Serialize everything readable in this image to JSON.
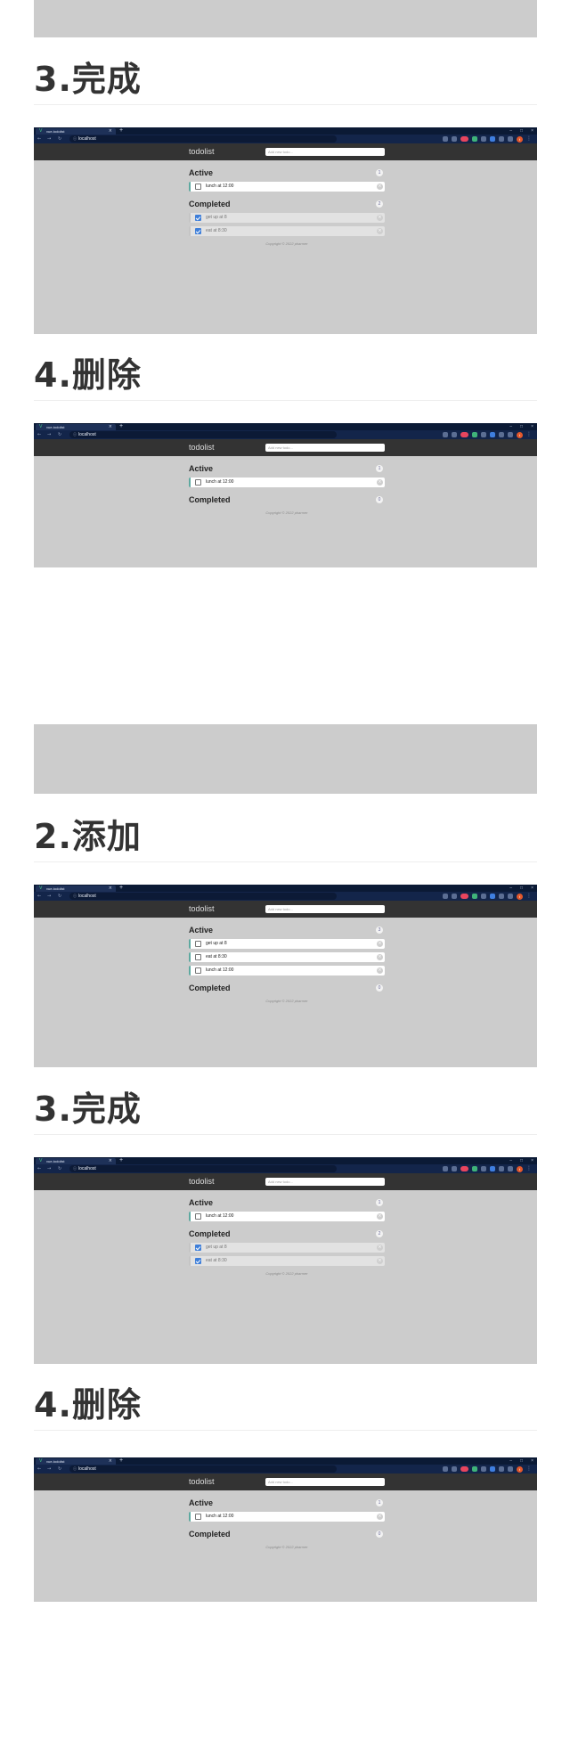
{
  "sections": [
    {
      "heading": "3.完成"
    },
    {
      "heading": "4.删除"
    },
    {
      "heading": "2.添加"
    },
    {
      "heading": "3.完成"
    },
    {
      "heading": "4.删除"
    }
  ],
  "browser": {
    "tab_title": "vue-todolist",
    "tab_close": "×",
    "new_tab": "+",
    "address": "localhost",
    "avatar_initial": "t"
  },
  "app": {
    "brand": "todolist",
    "input_placeholder": "Add new todo...",
    "active_label": "Active",
    "completed_label": "Completed",
    "copyright": "Copyright © 2022 pharmer"
  },
  "shots": [
    {
      "active_count": "1",
      "completed_count": "2",
      "active": [
        "lunch at 12:00"
      ],
      "completed": [
        "get up at 8",
        "eat at 8:30"
      ]
    },
    {
      "active_count": "1",
      "completed_count": "0",
      "active": [
        "lunch at 12:00"
      ],
      "completed": []
    },
    {
      "active_count": "3",
      "completed_count": "0",
      "active": [
        "get up at 8",
        "eat at 8:30",
        "lunch at 12:00"
      ],
      "completed": []
    },
    {
      "active_count": "1",
      "completed_count": "2",
      "active": [
        "lunch at 12:00"
      ],
      "completed": [
        "get up at 8",
        "eat at 8:30"
      ]
    },
    {
      "active_count": "1",
      "completed_count": "0",
      "active": [
        "lunch at 12:00"
      ],
      "completed": []
    }
  ]
}
